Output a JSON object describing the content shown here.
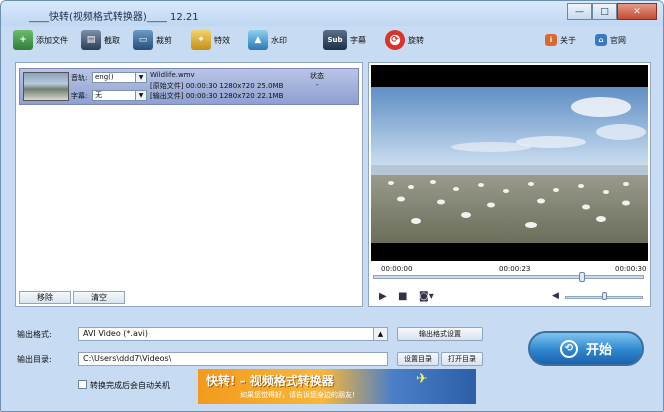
{
  "window": {
    "title_prefix": "____",
    "title_app": "快转(视频格式转换器)",
    "title_mid": "____",
    "title_version": "12.21",
    "minimize": "—",
    "maximize": "□",
    "close": "✕"
  },
  "toolbar": {
    "add_file": "添加文件",
    "crop": "截取",
    "clip": "裁剪",
    "effects": "特效",
    "watermark": "水印",
    "subtitle": "字幕",
    "subtitle_icon": "Sub",
    "rotate": "旋转",
    "about": "关于",
    "website": "官网"
  },
  "file_list": {
    "audio_track_label": "音轨:",
    "audio_track_value": "eng()",
    "subtitle_label": "字幕:",
    "subtitle_value": "无",
    "filename": "Wildlife.wmv",
    "status_header": "状态",
    "status_value": "-",
    "source_label": "[原始文件]",
    "source_duration": "00:00:30",
    "source_resolution": "1280x720",
    "source_size": "25.0MB",
    "output_label": "[输出文件]",
    "output_duration": "00:00:30",
    "output_resolution": "1280x720",
    "output_size": "22.1MB",
    "remove_button": "移除",
    "clear_button": "清空"
  },
  "player": {
    "time_start": "00:00:00",
    "time_current": "00:00:23",
    "time_end": "00:00:30",
    "progress_fraction": 0.77,
    "volume_fraction": 0.5
  },
  "output": {
    "format_label": "输出格式:",
    "format_value": "AVI Video (*.avi)",
    "format_settings_button": "输出格式设置",
    "dir_label": "输出目录:",
    "dir_value": "C:\\Users\\ddd7\\Videos\\",
    "set_dir_button": "设置目录",
    "open_dir_button": "打开目录",
    "shutdown_label": "转换完成后会自动关机",
    "shutdown_checked": false
  },
  "start_button": "开始",
  "banner": {
    "headline": "快转! – 视频格式转换器",
    "subline": "如果您觉得好，请告诉您身边的朋友!"
  },
  "colors": {
    "window_bg": "#c7dcf2",
    "accent_blue": "#2f86cf",
    "selection": "#8f9fd0",
    "banner_orange": "#f39a1c"
  }
}
